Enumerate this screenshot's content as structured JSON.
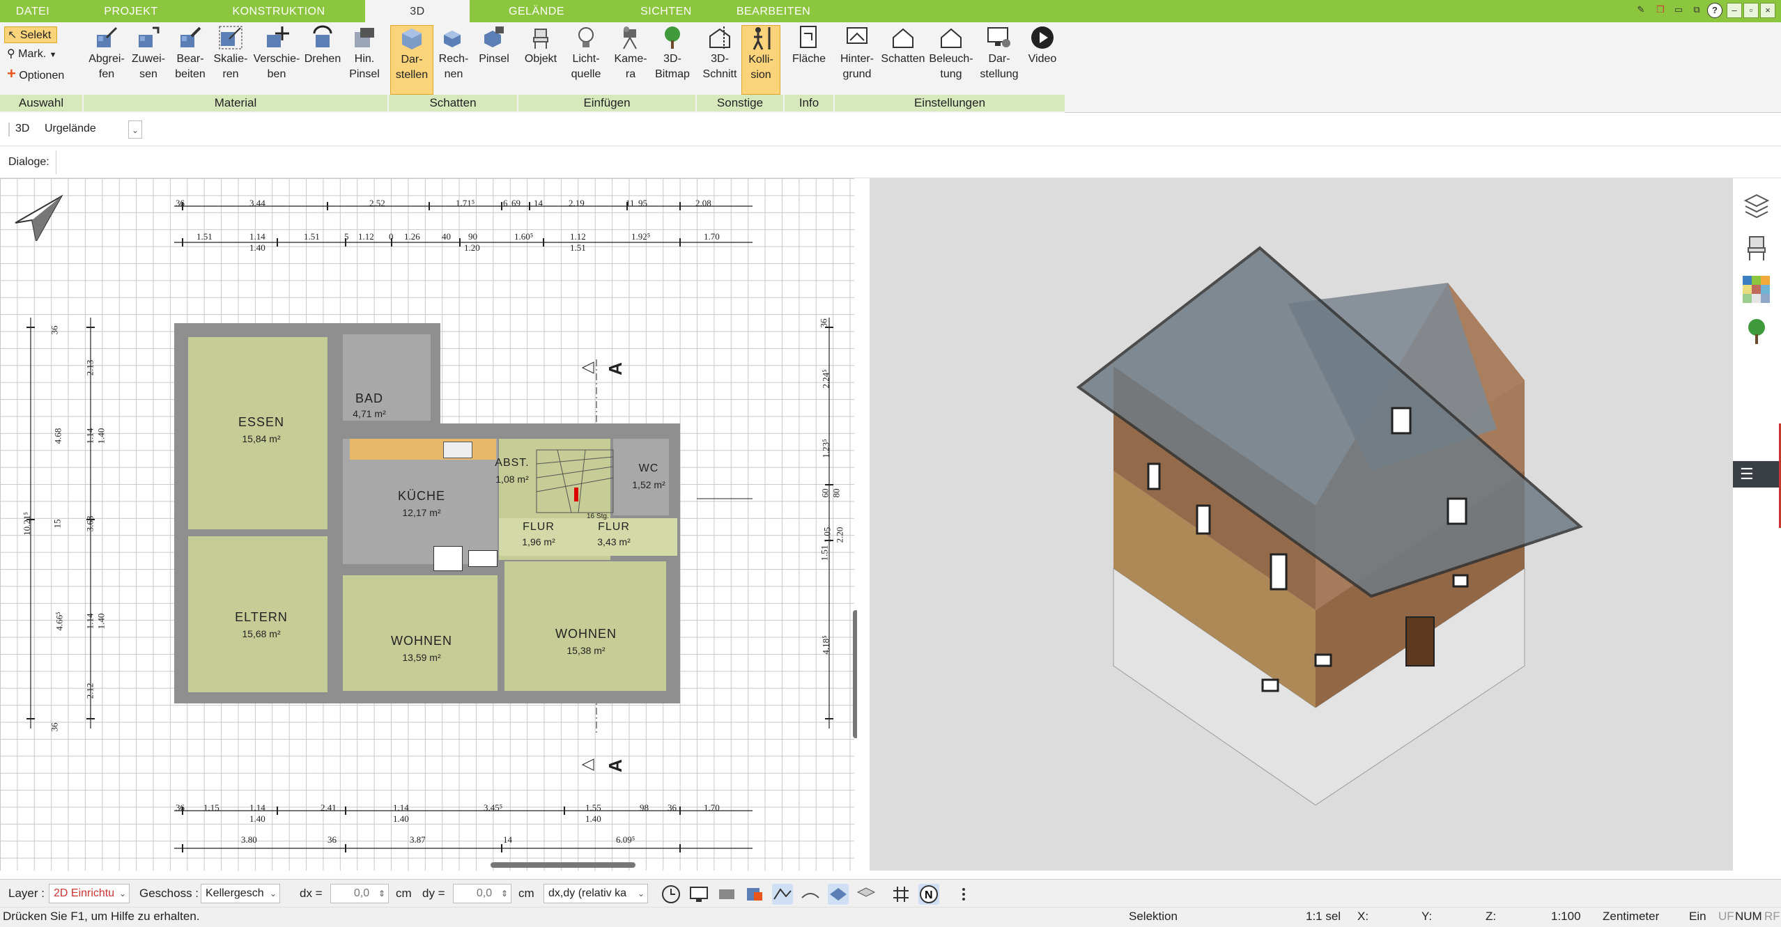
{
  "tabs": [
    "DATEI",
    "PROJEKT",
    "KONSTRUKTION",
    "3D",
    "GELÄNDE",
    "SICHTEN",
    "BEARBEITEN"
  ],
  "active_tab": "3D",
  "colors": {
    "accent": "#8cc63f",
    "group_bar": "#d8e8bd",
    "selected": "#fbd37a",
    "room_fill": "#c5cc95",
    "wall": "#8f8f8f",
    "view_bg": "#dcdcdc"
  },
  "auswahl": {
    "selekt": "Selekt",
    "mark": "Mark.",
    "optionen": "Optionen",
    "group": "Auswahl"
  },
  "material": {
    "group": "Material",
    "buttons": [
      "Abgrei-\nfen",
      "Zuwei-\nsen",
      "Bear-\nbeiten",
      "Skalie-\nren",
      "Verschie-\nben",
      "Drehen",
      "Hin.\nPinsel"
    ]
  },
  "schatten": {
    "group": "Schatten",
    "buttons": [
      "Dar-\nstellen",
      "Rech-\nnen",
      "Pinsel"
    ]
  },
  "einfuegen": {
    "group": "Einfügen",
    "buttons": [
      "Objekt",
      "Licht-\nquelle",
      "Kame-\nra",
      "3D-\nBitmap"
    ]
  },
  "sonstige": {
    "group": "Sonstige",
    "buttons": [
      "3D-\nSchnitt",
      "Kolli-\nsion"
    ]
  },
  "info": {
    "group": "Info",
    "buttons": [
      "Fläche"
    ]
  },
  "einstellungen": {
    "group": "Einstellungen",
    "buttons": [
      "Hinter-\ngrund",
      "Schatten",
      "Beleuch-\ntung",
      "Dar-\nstellung",
      "Video"
    ]
  },
  "view_row": {
    "label": "3D",
    "value": "Urgelände"
  },
  "dialog_row": {
    "label": "Dialoge:"
  },
  "rooms": [
    {
      "name": "ESSEN",
      "area": "15,84 m²"
    },
    {
      "name": "BAD",
      "area": "4,71 m²"
    },
    {
      "name": "KÜCHE",
      "area": "12,17 m²"
    },
    {
      "name": "ABST.",
      "area": "1,08 m²"
    },
    {
      "name": "WC",
      "area": "1,52 m²"
    },
    {
      "name": "FLUR",
      "area": "1,96 m²"
    },
    {
      "name": "FLUR",
      "area": "3,43 m²"
    },
    {
      "name": "ELTERN",
      "area": "15,68 m²"
    },
    {
      "name": "WOHNEN",
      "area": "13,59 m²"
    },
    {
      "name": "WOHNEN",
      "area": "15,38 m²"
    }
  ],
  "section_marker": "A",
  "dims_top1": [
    "36",
    "3.44",
    "2.52",
    "1.71⁵",
    "6",
    "69",
    "14",
    "2.19",
    "11",
    "95",
    "2.08"
  ],
  "dims_top2": [
    "1.51",
    "1.14",
    "1.40",
    "1.51",
    "5",
    "1.12",
    "0",
    "1.26",
    "40",
    "90",
    "1.20",
    "1.60⁵",
    "1.12",
    "1.51",
    "1.92⁵",
    "1.70"
  ],
  "dims_bottom1": [
    "36",
    "1.15",
    "1.14",
    "1.40",
    "2.41",
    "1.14",
    "1.40",
    "3.45⁵",
    "1.55",
    "1.40",
    "98",
    "36",
    "1.70"
  ],
  "dims_bottom2": [
    "3.80",
    "36",
    "3.87",
    "14",
    "6.09⁵"
  ],
  "dims_left": [
    "36",
    "2.13",
    "4.68",
    "1.14",
    "1.40",
    "10.21⁵",
    "15",
    "3.68",
    "4.66⁵",
    "1.14",
    "1.40",
    "2.12",
    "36"
  ],
  "dims_right": [
    "36",
    "2.24⁵",
    "1.23⁵",
    "60",
    "80",
    "1.05",
    "2.20",
    "1.51",
    "4.18⁵"
  ],
  "stair_note": "16 Stg.",
  "statusbar": {
    "layer_label": "Layer :",
    "layer_value": "2D Einrichtu",
    "geschoss_label": "Geschoss :",
    "geschoss_value": "Kellergesch",
    "dx_label": "dx =",
    "dx_value": "0,0",
    "dy_label": "dy =",
    "dy_value": "0,0",
    "unit": "cm",
    "mode": "dx,dy (relativ ka"
  },
  "statusline": {
    "help": "Drücken Sie F1, um Hilfe zu erhalten.",
    "mode": "Selektion",
    "sel": "1:1 sel",
    "x": "X:",
    "y": "Y:",
    "z": "Z:",
    "scale": "1:100",
    "unit": "Zentimeter",
    "ein": "Ein",
    "uf": "UF",
    "num": "NUM",
    "rf": "RF"
  },
  "right_icons": [
    "layers-icon",
    "chair-icon",
    "palette-icon",
    "tree-icon"
  ]
}
